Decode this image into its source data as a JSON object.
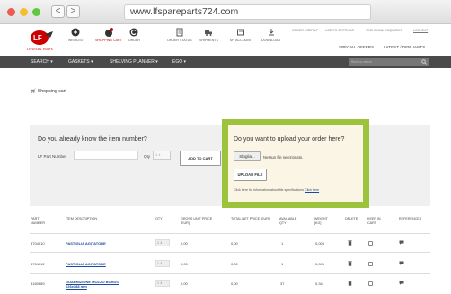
{
  "browser": {
    "url": "www.lfspareparts724.com",
    "back": "<",
    "forward": ">"
  },
  "header": {
    "logo_text": "LF SPARE PARTS",
    "icons": [
      {
        "name": "wishlist",
        "label": "WISHLIST"
      },
      {
        "name": "shopping-cart",
        "label": "SHOPPING CART"
      },
      {
        "name": "order",
        "label": "ORDER"
      },
      {
        "name": "order-status",
        "label": "ORDER STATUS"
      },
      {
        "name": "shipments",
        "label": "SHIPMENTS"
      },
      {
        "name": "my-account",
        "label": "MY ACCOUNT"
      },
      {
        "name": "download",
        "label": "DOWNLOAD"
      }
    ],
    "top_links": [
      "ORDER USER LF",
      "USER'S SETTINGS",
      "TECHNICAL ENQUIRIES",
      "LOG OUT"
    ],
    "special_offers": "SPECIAL OFFERS",
    "latest": "LATEST / DEPLIANTS"
  },
  "menu": {
    "items": [
      "SEARCH",
      "GASKETS",
      "SHELVING PLANNER",
      "EGO"
    ],
    "search_placeholder": "Ricerca veloce"
  },
  "breadcrumb": "Shopping cart",
  "item_panel": {
    "question": "Do you already know the item number?",
    "lf_part_label": "LF Part Number",
    "qty_label": "Qty",
    "qty_value": "1",
    "add_button": "ADD TO CART"
  },
  "upload_panel": {
    "question": "Do you want to upload your order here?",
    "file_button": "Sfoglia...",
    "file_status": "Nessun file selezionato.",
    "upload_button": "UPLOAD FILE",
    "help_text": "Click here for information about file specifications",
    "help_link": "Click here"
  },
  "table": {
    "headers": [
      "PART NUMBER",
      "ITEM DESCRIPTION",
      "QTY",
      "GROSS UNIT PRICE [EUR]",
      "TOTAL NET PRICE [EUR]",
      "AVAILABLE QTY",
      "WEIGHT [KG]",
      "DELETE",
      "KEEP IN CART",
      "REFERENCES"
    ],
    "rows": [
      {
        "part": "3704010",
        "desc": "PASTIGLIA AGITATORE",
        "qty": "1",
        "gross": "0,00",
        "net": "0,00",
        "avail": "1",
        "weight": "0,005"
      },
      {
        "part": "3704012",
        "desc": "PASTIGLIA AGITATORE",
        "qty": "1",
        "gross": "0,00",
        "net": "0,00",
        "avail": "1",
        "weight": "0,006"
      },
      {
        "part": "3160689",
        "desc": "GUARNIZIONE MOZZO BORDO 626x388 mm",
        "qty": "1",
        "gross": "0,00",
        "net": "0,00",
        "avail": "37",
        "weight": "0,34"
      }
    ]
  },
  "colors": {
    "accent_red": "#cc0000",
    "highlight_green": "#9dc23b",
    "menu_bg": "#4a4a4a",
    "link_blue": "#1a4a9b"
  }
}
